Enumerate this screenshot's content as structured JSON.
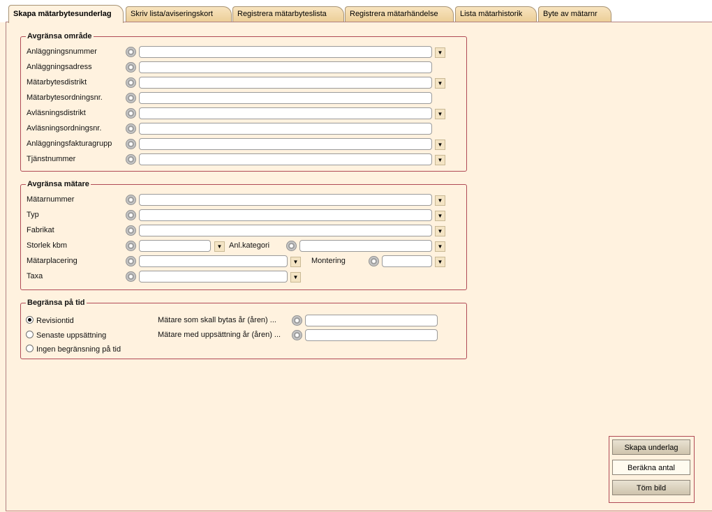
{
  "tabs": [
    {
      "label": "Skapa mätarbytesunderlag"
    },
    {
      "label": "Skriv lista/aviseringskort"
    },
    {
      "label": "Registrera mätarbyteslista"
    },
    {
      "label": "Registrera mätarhändelse"
    },
    {
      "label": "Lista mätarhistorik"
    },
    {
      "label": "Byte av mätarnr"
    }
  ],
  "area": {
    "title": "Avgränsa område",
    "fields": [
      {
        "label": "Anläggningsnummer"
      },
      {
        "label": "Anläggningsadress"
      },
      {
        "label": "Mätarbytesdistrikt"
      },
      {
        "label": "Mätarbytesordningsnr."
      },
      {
        "label": "Avläsningsdistrikt"
      },
      {
        "label": "Avläsningsordningsnr."
      },
      {
        "label": "Anläggningsfakturagrupp"
      },
      {
        "label": "Tjänstnummer"
      }
    ]
  },
  "meter": {
    "title": "Avgränsa mätare",
    "fields": [
      {
        "label": "Mätarnummer"
      },
      {
        "label": "Typ"
      },
      {
        "label": "Fabrikat"
      },
      {
        "label": "Storlek kbm"
      },
      {
        "label": "Anl.kategori"
      },
      {
        "label": "Mätarplacering"
      },
      {
        "label": "Montering"
      },
      {
        "label": "Taxa"
      }
    ]
  },
  "time": {
    "title": "Begränsa på tid",
    "options": [
      {
        "label": "Revisiontid",
        "selected": true
      },
      {
        "label": "Senaste uppsättning",
        "selected": false
      },
      {
        "label": "Ingen begränsning på tid",
        "selected": false
      }
    ],
    "change_year_label": "Mätare som skall bytas år (åren) ...",
    "setup_year_label": "Mätare med uppsättning år (åren) ..."
  },
  "buttons": {
    "create": "Skapa underlag",
    "count": "Beräkna antal",
    "clear": "Töm bild"
  },
  "icons": {
    "gear": "gear-icon",
    "dropdown": "chevron-down-icon"
  }
}
